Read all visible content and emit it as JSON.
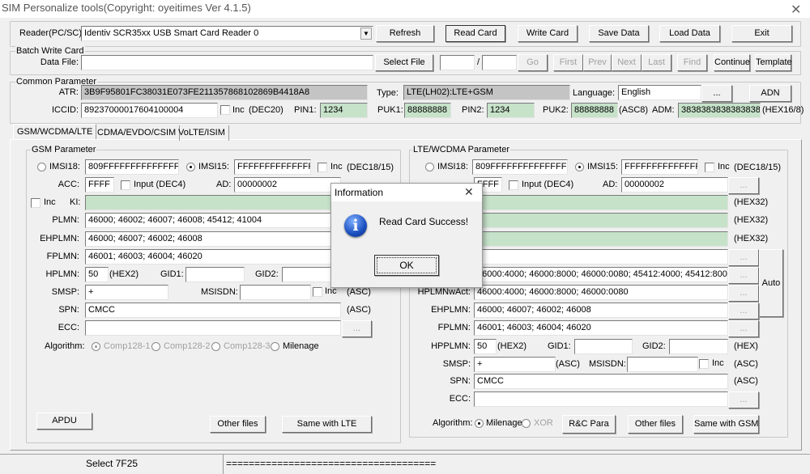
{
  "window": {
    "title": "SIM Personalize tools(Copyright: oyeitimes Ver 4.1.5)"
  },
  "reader": {
    "label": "Reader(PC/SC):",
    "value": "Identiv SCR35xx USB Smart Card Reader 0",
    "buttons": [
      "Refresh",
      "Read Card",
      "Write Card",
      "Save Data",
      "Load Data",
      "Exit"
    ]
  },
  "batch": {
    "group": "Batch Write Card",
    "data_file_label": "Data File:",
    "data_file": "",
    "select_file": "Select File",
    "page_from": "",
    "slash": "/",
    "page_to": "",
    "nav": [
      "Go",
      "First",
      "Prev",
      "Next",
      "Last",
      "Find"
    ],
    "continue": "Continue",
    "template": "Template"
  },
  "common": {
    "group": "Common Parameter",
    "atr_label": "ATR:",
    "atr": "3B9F95801FC38031E073FE211357868102869B4418A8",
    "type_label": "Type:",
    "type": "LTE(LH02):LTE+GSM",
    "language_label": "Language:",
    "language": "English",
    "more": "...",
    "adn": "ADN",
    "iccid_label": "ICCID:",
    "iccid": "89237000017604100004",
    "inc": "Inc",
    "dec20": "(DEC20)",
    "pin1_label": "PIN1:",
    "pin1": "1234",
    "puk1_label": "PUK1:",
    "puk1": "88888888",
    "pin2_label": "PIN2:",
    "pin2": "1234",
    "puk2_label": "PUK2:",
    "puk2": "88888888",
    "asc8": "(ASC8)",
    "adm_label": "ADM:",
    "adm": "3838383838383838",
    "hex168": "(HEX16/8)"
  },
  "tabs": [
    "GSM/WCDMA/LTE",
    "CDMA/EVDO/CSIM",
    "VoLTE/ISIM"
  ],
  "gsm": {
    "group": "GSM Parameter",
    "imsi18_label": "IMSI18:",
    "imsi18": "809FFFFFFFFFFFFFFF",
    "imsi15_label": "IMSI15:",
    "imsi15": "FFFFFFFFFFFFFFF",
    "inc": "Inc",
    "dec1815": "(DEC18/15)",
    "acc_label": "ACC:",
    "acc": "FFFF",
    "input_dec4": "Input (DEC4)",
    "ad_label": "AD:",
    "ad": "00000002",
    "more": "...",
    "ki_inc": "Inc",
    "ki_label": "KI:",
    "ki": "",
    "plmn_label": "PLMN:",
    "plmn": "46000; 46002; 46007; 46008; 45412; 41004",
    "ehplmn_label": "EHPLMN:",
    "ehplmn": "46000; 46007; 46002; 46008",
    "fplmn_label": "FPLMN:",
    "fplmn": "46001; 46003; 46004; 46020",
    "hplmn_label": "HPLMN:",
    "hplmn": "50",
    "hex2": "(HEX2)",
    "gid1_label": "GID1:",
    "gid1": "",
    "gid2_label": "GID2:",
    "gid2": "",
    "smsp_label": "SMSP:",
    "smsp": "+",
    "msisdn_label": "MSISDN:",
    "msisdn": "",
    "msisdn_inc": "Inc",
    "asc": "(ASC)",
    "spn_label": "SPN:",
    "spn": "CMCC",
    "ecc_label": "ECC:",
    "ecc": "",
    "algorithm_label": "Algorithm:",
    "algorithms": [
      "Comp128-1",
      "Comp128-2",
      "Comp128-3",
      "Milenage"
    ],
    "apdu": "APDU",
    "other_files": "Other files",
    "same_with": "Same with LTE"
  },
  "lte": {
    "group": "LTE/WCDMA Parameter",
    "imsi18_label": "IMSI18:",
    "imsi18": "809FFFFFFFFFFFFFFF",
    "imsi15_label": "IMSI15:",
    "imsi15": "FFFFFFFFFFFFFFF",
    "inc": "Inc",
    "dec1815": "(DEC18/15)",
    "acc": "FFFF",
    "input_dec4": "Input (DEC4)",
    "ad_label": "AD:",
    "ad": "00000002",
    "more": "...",
    "hex32": "(HEX32)",
    "oplmnwact": "46000:4000; 46000:8000; 46000:0080; 45412:4000; 45412:8000; 4541",
    "hplmnwact_label": "HPLMNwAct:",
    "hplmnwact": "46000:4000; 46000:8000; 46000:0080",
    "auto": "Auto",
    "ehplmn_label": "EHPLMN:",
    "ehplmn": "46000; 46007; 46002; 46008",
    "fplmn_label": "FPLMN:",
    "fplmn": "46001; 46003; 46004; 46020",
    "hpplmn_label": "HPPLMN:",
    "hpplmn": "50",
    "hex2": "(HEX2)",
    "gid1_label": "GID1:",
    "gid2_label": "GID2:",
    "hex": "(HEX)",
    "smsp_label": "SMSP:",
    "smsp": "+",
    "asc": "(ASC)",
    "msisdn_label": "MSISDN:",
    "msisdn_inc": "Inc",
    "spn_label": "SPN:",
    "spn": "CMCC",
    "ecc_label": "ECC:",
    "algorithm_label": "Algorithm:",
    "algorithms": [
      "Milenage",
      "XOR"
    ],
    "rc_para": "R&C Para",
    "other_files": "Other files",
    "same_with": "Same with GSM"
  },
  "status": {
    "left": "Select 7F25",
    "right": "====================================="
  },
  "dialog": {
    "title": "Information",
    "message": "Read Card Success!",
    "ok": "OK",
    "icon": "info-icon"
  },
  "colors": {
    "green_field": "#c6e2c9",
    "readonly_field": "#c4c4c4"
  }
}
